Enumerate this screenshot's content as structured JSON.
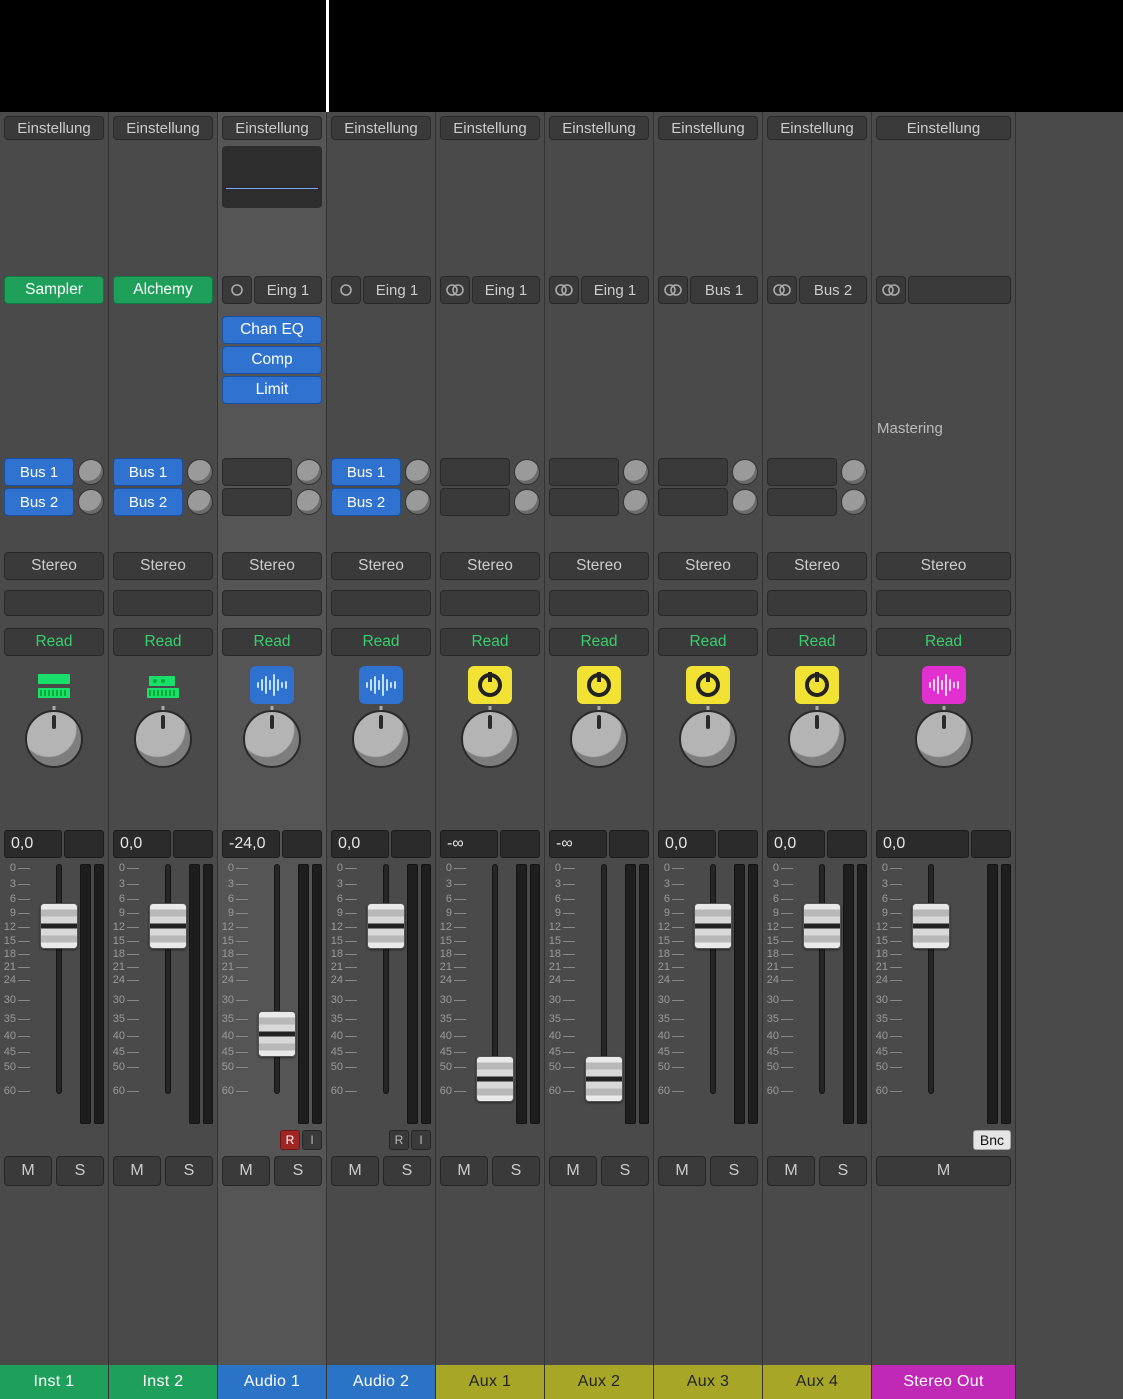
{
  "labels": {
    "settings": "Einstellung",
    "stereo": "Stereo",
    "read": "Read",
    "mute": "M",
    "solo": "S",
    "rec": "R",
    "input_mon": "I",
    "bounce": "Bnc",
    "mastering": "Mastering"
  },
  "inserts": {
    "chan_eq": "Chan EQ",
    "comp": "Comp",
    "limit": "Limit"
  },
  "sends": {
    "bus1": "Bus 1",
    "bus2": "Bus 2"
  },
  "inputs": {
    "eing1": "Eing 1"
  },
  "instruments": {
    "sampler": "Sampler",
    "alchemy": "Alchemy"
  },
  "channels": [
    {
      "name": "Inst 1",
      "color": "c-green",
      "gain": "0,0",
      "fader": 62,
      "inst": "sampler",
      "icon": "inst-green",
      "io": null,
      "sends": [
        "bus1",
        "bus2"
      ],
      "ri": null,
      "bnc": false,
      "solo": true
    },
    {
      "name": "Inst 2",
      "color": "c-green",
      "gain": "0,0",
      "fader": 62,
      "inst": "alchemy",
      "icon": "synth-green",
      "io": null,
      "sends": [
        "bus1",
        "bus2"
      ],
      "ri": null,
      "bnc": false,
      "solo": true
    },
    {
      "name": "Audio 1",
      "color": "c-blue",
      "gain": "-24,0",
      "fader": 170,
      "inst": null,
      "icon": "wave-blue",
      "io": {
        "format": "mono",
        "label": "eing1"
      },
      "eq": true,
      "fx": [
        "chan_eq",
        "comp",
        "limit"
      ],
      "sends": [],
      "ri": "rec",
      "selected": true,
      "bnc": false,
      "solo": true
    },
    {
      "name": "Audio 2",
      "color": "c-blue",
      "gain": "0,0",
      "fader": 62,
      "inst": null,
      "icon": "wave-blue",
      "io": {
        "format": "mono",
        "label": "eing1"
      },
      "sends": [
        "bus1",
        "bus2"
      ],
      "ri": "idle",
      "bnc": false,
      "solo": true
    },
    {
      "name": "Aux 1",
      "color": "c-olive",
      "gain": "-∞",
      "fader": 215,
      "inst": null,
      "icon": "aux-yellow",
      "io": {
        "format": "stereo",
        "label": "eing1"
      },
      "sends": [],
      "ri": null,
      "bnc": false,
      "solo": true
    },
    {
      "name": "Aux 2",
      "color": "c-olive",
      "gain": "-∞",
      "fader": 215,
      "inst": null,
      "icon": "aux-yellow",
      "io": {
        "format": "stereo",
        "label": "eing1"
      },
      "sends": [],
      "ri": null,
      "bnc": false,
      "solo": true
    },
    {
      "name": "Aux 3",
      "color": "c-olive",
      "gain": "0,0",
      "fader": 62,
      "inst": null,
      "icon": "aux-yellow",
      "io": {
        "format": "stereo",
        "label": "bus1"
      },
      "sends": [],
      "ri": null,
      "bnc": false,
      "solo": true
    },
    {
      "name": "Aux 4",
      "color": "c-olive",
      "gain": "0,0",
      "fader": 62,
      "inst": null,
      "icon": "aux-yellow",
      "io": {
        "format": "stereo",
        "label": "bus2"
      },
      "sends": [],
      "ri": null,
      "bnc": false,
      "solo": true
    },
    {
      "name": "Stereo Out",
      "color": "c-magenta",
      "gain": "0,0",
      "fader": 62,
      "inst": null,
      "icon": "wave-magenta",
      "io": {
        "format": "stereo",
        "label": ""
      },
      "sends": [],
      "ri": null,
      "mastering": true,
      "bnc": true,
      "solo": false
    }
  ],
  "scale": [
    "0",
    "3",
    "6",
    "9",
    "12",
    "15",
    "18",
    "21",
    "24",
    "30",
    "35",
    "40",
    "45",
    "50",
    "60"
  ],
  "io_bus": {
    "bus1": "Bus 1",
    "bus2": "Bus 2"
  }
}
